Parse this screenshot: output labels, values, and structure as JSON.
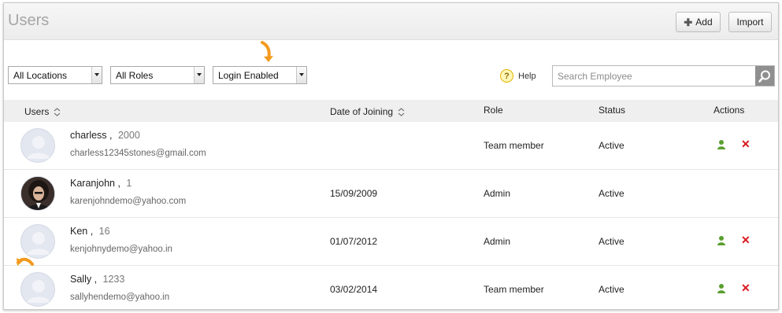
{
  "header": {
    "title": "Users",
    "add_label": "Add",
    "import_label": "Import"
  },
  "filters": {
    "location": "All Locations",
    "role": "All Roles",
    "login": "Login Enabled"
  },
  "help_label": "Help",
  "search": {
    "placeholder": "Search Employee"
  },
  "columns": {
    "users": "Users",
    "date": "Date of Joining",
    "role": "Role",
    "status": "Status",
    "actions": "Actions"
  },
  "rows": [
    {
      "name": "charless",
      "id": "2000",
      "email": "charless12345stones@gmail.com",
      "date": "",
      "role": "Team member",
      "status": "Active"
    },
    {
      "name": "Karanjohn",
      "id": "1",
      "email": "karenjohndemo@yahoo.com",
      "date": "15/09/2009",
      "role": "Admin",
      "status": "Active"
    },
    {
      "name": "Ken",
      "id": "16",
      "email": "kenjohnydemo@yahoo.in",
      "date": "01/07/2012",
      "role": "Admin",
      "status": "Active"
    },
    {
      "name": "Sally",
      "id": "1233",
      "email": "sallyhendemo@yahoo.in",
      "date": "03/02/2014",
      "role": "Team member",
      "status": "Active"
    }
  ],
  "icons": {
    "add": "plus-icon",
    "help": "question-icon",
    "search": "magnifier-icon",
    "sort": "sort-icon",
    "user_action": "user-icon",
    "delete_action": "close-icon",
    "pointer": "curved-arrow-icon"
  },
  "colors": {
    "accent_pointer": "#f39a1e",
    "delete": "#d9181c",
    "user_action": "#5a9e2f",
    "title": "#a6a6a6"
  }
}
